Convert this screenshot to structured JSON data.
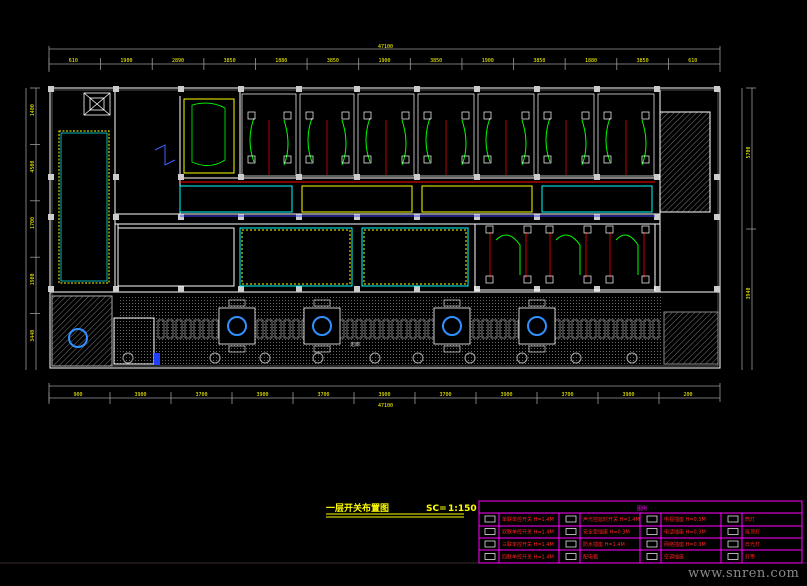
{
  "drawing": {
    "title": "一层开关布置图",
    "scale_label": "SC=",
    "scale_value": "1:150",
    "colors": {
      "wall": "#ffffff",
      "dimension": "#ffff00",
      "wiring_green": "#00ff00",
      "wiring_red": "#ff0000",
      "wiring_blue": "#0000ff",
      "lighting_cyan": "#00ffff",
      "legend_frame": "#ff00ff",
      "legend_text": "#ff2020"
    },
    "top_dims": [
      "610",
      "1900",
      "2890",
      "3850",
      "1880",
      "3850",
      "1900",
      "3850",
      "1900",
      "3850",
      "1880",
      "3850",
      "610"
    ],
    "bottom_dims": [
      "900",
      "3900",
      "3700",
      "3900",
      "3700",
      "3900",
      "3700",
      "3900",
      "3700",
      "3900",
      "200"
    ],
    "total_top": "47100",
    "total_bottom": "47100",
    "left_dims": [
      "1400",
      "4500",
      "1700",
      "1900",
      "3440"
    ],
    "right_dims": [
      "5700",
      "3940"
    ],
    "corridor_label": "走廊"
  },
  "legend": {
    "header": "图例",
    "items": [
      {
        "icon": "switch-single-icon",
        "label": "单联单控开关 H=1.4M"
      },
      {
        "icon": "switch-double-icon",
        "label": "双联单控开关 H=1.4M"
      },
      {
        "icon": "switch-triple-icon",
        "label": "三联单控开关 H=1.4M"
      },
      {
        "icon": "switch-quad-icon",
        "label": "四联单控开关 H=1.4M"
      },
      {
        "icon": "switch-delay-icon",
        "label": "声光控延时开关 H=1.4M"
      },
      {
        "icon": "socket-icon",
        "label": "安全型插座 H=0.3M"
      },
      {
        "icon": "socket-waterproof-icon",
        "label": "防水插座 H=1.4M"
      },
      {
        "icon": "distribution-box-icon",
        "label": "配电箱"
      },
      {
        "icon": "tv-socket-icon",
        "label": "电视插座 H=0.3M"
      },
      {
        "icon": "phone-socket-icon",
        "label": "电话插座 H=0.3M"
      },
      {
        "icon": "network-socket-icon",
        "label": "网络插座 H=0.3M"
      },
      {
        "icon": "ac-socket-icon",
        "label": "空调插座"
      },
      {
        "icon": "downlight-icon",
        "label": "筒灯"
      },
      {
        "icon": "ceiling-light-icon",
        "label": "吸顶灯"
      },
      {
        "icon": "fluorescent-icon",
        "label": "日光灯"
      },
      {
        "icon": "strip-light-icon",
        "label": "灯带"
      }
    ]
  },
  "watermark": "www.snren.com"
}
